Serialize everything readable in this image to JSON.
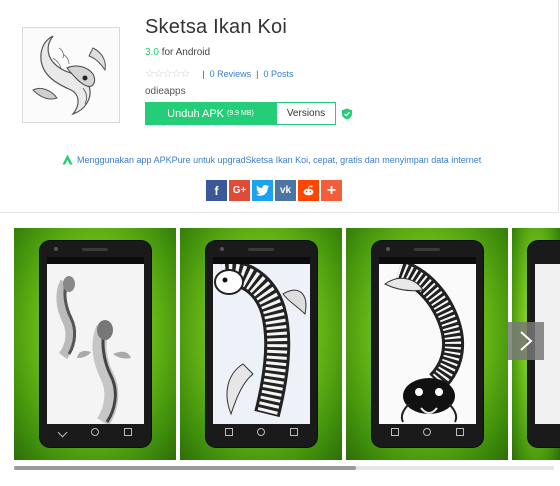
{
  "app": {
    "title": "Sketsa Ikan Koi",
    "version": "3.0",
    "platform": "for Android",
    "rating_stars": "☆☆☆☆☆",
    "reviews_label": "0 Reviews",
    "posts_label": "0 Posts",
    "developer": "odieapps"
  },
  "buttons": {
    "download_label": "Unduh APK",
    "download_size": "(9.9 MB)",
    "versions_label": "Versions"
  },
  "promo": {
    "text": "Menggunakan app APKPure untuk upgradSketsa Ikan Koi, cepat, gratis dan menyimpan data internet"
  },
  "share": {
    "buttons": [
      {
        "glyph": "f",
        "icon": "facebook-icon",
        "color": "#3b5998"
      },
      {
        "glyph": "G+",
        "icon": "google-plus-icon",
        "color": "#dd4b39"
      },
      {
        "glyph": "t",
        "icon": "twitter-icon",
        "color": "#1da1f2"
      },
      {
        "glyph": "vk",
        "icon": "vk-icon",
        "color": "#4c75a3"
      },
      {
        "glyph": "r",
        "icon": "reddit-icon",
        "color": "#ff4500"
      },
      {
        "glyph": "+",
        "icon": "share-more-icon",
        "color": "#f25e3b"
      }
    ]
  },
  "gallery": {
    "screenshots": [
      "screenshot-1",
      "screenshot-2",
      "screenshot-3",
      "screenshot-4"
    ],
    "scroll_progress": 0.63
  },
  "colors": {
    "accent": "#24cd77",
    "link": "#3a7ccd"
  }
}
